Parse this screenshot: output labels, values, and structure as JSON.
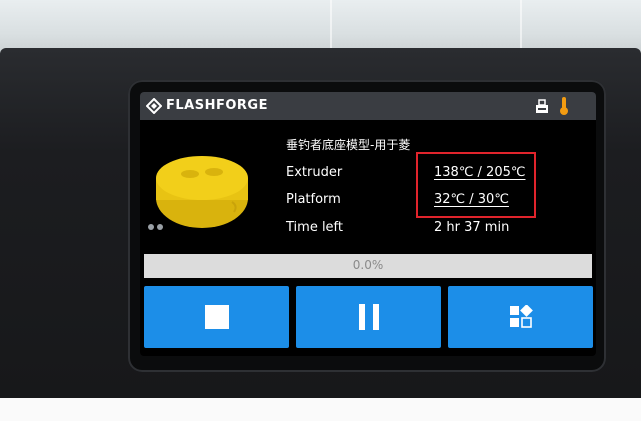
{
  "header": {
    "brand": "FLASHFORGE",
    "icons": [
      "flashforge-logo-icon",
      "usb-drive-icon",
      "thermometer-icon"
    ]
  },
  "print_job": {
    "file_name": "垂钓者底座模型-用于菱",
    "thumbnail": "yellow-round-model-thumbnail",
    "extruder_label": "Extruder",
    "extruder_value": "138℃ / 205℃",
    "platform_label": "Platform",
    "platform_value": "32℃ / 30℃",
    "time_label": "Time left",
    "time_value": "2 hr 37 min"
  },
  "progress": {
    "text": "0.0%",
    "fraction": 0.0
  },
  "controls": {
    "buttons": [
      {
        "name": "stop",
        "icon": "stop-icon"
      },
      {
        "name": "pause",
        "icon": "pause-icon"
      },
      {
        "name": "more",
        "icon": "grid-menu-icon"
      }
    ]
  },
  "colors": {
    "button_blue": "#1c8ee8",
    "header_gray": "#3a3d42",
    "highlight_red": "#e1242c",
    "model_yellow": "#f2cf1a",
    "thermometer_orange": "#f39c12"
  }
}
